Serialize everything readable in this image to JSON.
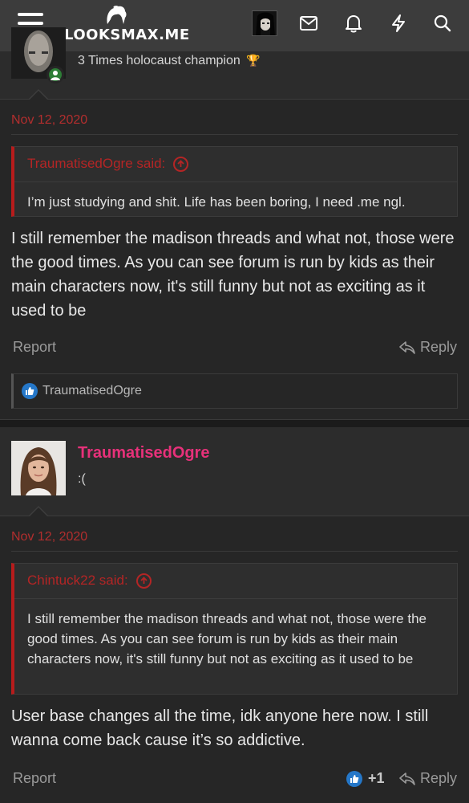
{
  "header": {
    "logo_text": "LOOKSMAX.ME"
  },
  "post1": {
    "user_title": "3 Times holocaust champion",
    "date": "Nov 12, 2020",
    "quote": {
      "author": "TraumatisedOgre said:",
      "text": "I’m just studying and shit. Life has been boring, I need .me ngl."
    },
    "message": "I still remember the madison threads and what not, those were the good times. As you can see forum is run by kids as their main characters now, it's still funny but not as exciting as it used to be",
    "report_label": "Report",
    "reply_label": "Reply",
    "reaction_user": "TraumatisedOgre"
  },
  "post2": {
    "username": "TraumatisedOgre",
    "user_title": ":(",
    "date": "Nov 12, 2020",
    "quote": {
      "author": "Chintuck22 said:",
      "text": "I still remember the madison threads and what not, those were the good times. As you can see forum is run by kids as their main characters now, it's still funny but not as exciting as it used to be"
    },
    "message": "User base changes all the time, idk anyone here now. I still wanna come back cause it’s so addictive.",
    "report_label": "Report",
    "reply_label": "Reply",
    "like_count": "+1"
  },
  "colors": {
    "header_bg": "#3c3c3c",
    "post_bg": "#262626",
    "username": "#e7317a",
    "date": "#b22e2e",
    "quote_accent": "#b71c1c",
    "like_blue": "#2577c8"
  },
  "icons": [
    "menu-icon",
    "envelope-icon",
    "bell-icon",
    "lightning-icon",
    "search-icon",
    "reply-icon",
    "like-icon",
    "arrow-up-circle-icon",
    "trophy-icon"
  ]
}
